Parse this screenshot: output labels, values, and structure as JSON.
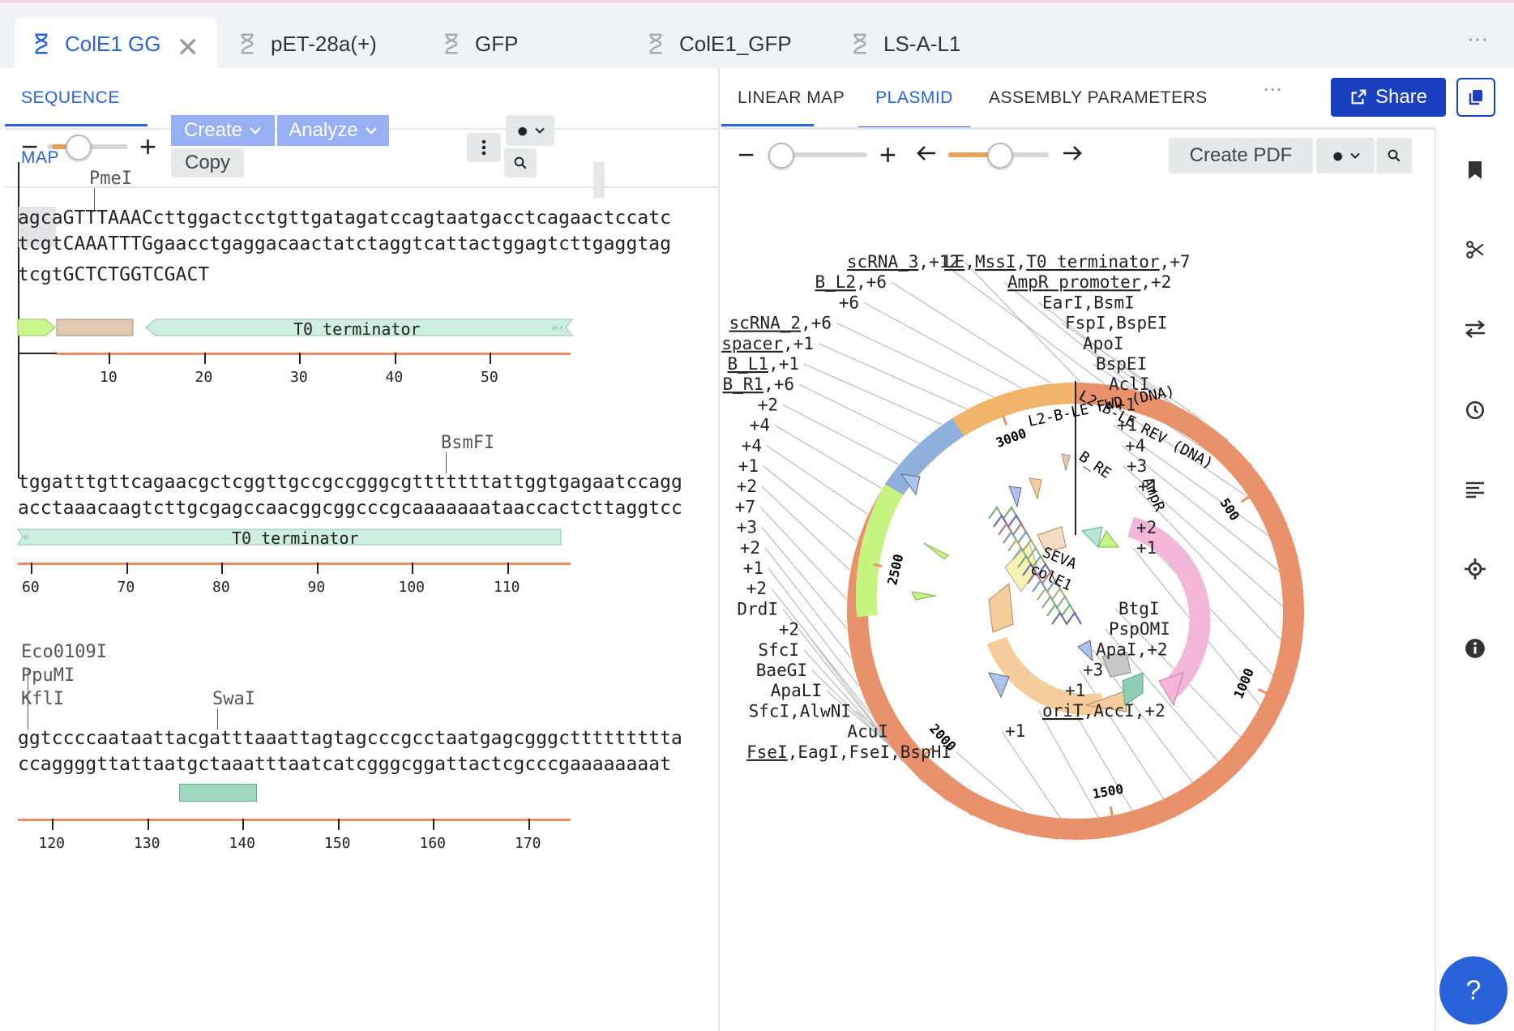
{
  "tabs": [
    {
      "label": "ColE1 GG",
      "active": true
    },
    {
      "label": "pET-28a(+)"
    },
    {
      "label": "GFP"
    },
    {
      "label": "ColE1_GFP"
    },
    {
      "label": "LS-A-L1"
    }
  ],
  "tab_more": "⋯",
  "left": {
    "subtab": "SEQUENCE MAP",
    "toolbar": {
      "create": "Create",
      "analyze": "Analyze",
      "copy": "Copy",
      "minus": "−",
      "plus": "+",
      "zoom": 0.25
    },
    "rows": [
      {
        "cuts": [
          "PmeI"
        ],
        "top": "agcaGTTTAAACcttggactcctgttgatagatccagtaatgacctcagaactccatc",
        "bottom": "tcgtCAAATTTGgaacctgaggacaactatctaggtcattactggagtcttgaggtag",
        "extra": "tcgtGCTCTGGTCGACT",
        "feature": "T0 terminator",
        "ticks": [
          "10",
          "20",
          "30",
          "40",
          "50"
        ]
      },
      {
        "cuts": [
          "BsmFI"
        ],
        "top": "tggatttgttcagaacgctcggttgccgccgggcgtttttttattggtgagaatccagg",
        "bottom": "acctaaacaagtcttgcgagccaacggcggcccgcaaaaaaataaccactcttaggtcc",
        "feature": "T0 terminator",
        "ticks": [
          "60",
          "70",
          "80",
          "90",
          "100",
          "110"
        ]
      },
      {
        "cuts": [
          "Eco0109I",
          "PpuMI",
          "KflI",
          "SwaI"
        ],
        "top": "ggtccccaataattacgatttaaattagtagcccgcctaatgagcgggcttttttttta",
        "bottom": "ccaggggttattaatgctaaatttaatcatcgggcggattactcgcccgaaaaaaaat",
        "ticks": [
          "120",
          "130",
          "140",
          "150",
          "160",
          "170"
        ]
      }
    ]
  },
  "right": {
    "subtabs": [
      "LINEAR MAP",
      "PLASMID",
      "ASSEMBLY PARAMETERS"
    ],
    "active_subtab": "PLASMID",
    "more": "⋯",
    "share": "Share",
    "create_pdf": "Create PDF",
    "zoom": 0.1,
    "rotation": 0.5,
    "plasmid": {
      "ring_ticks": [
        "500",
        "1000",
        "1500",
        "2000",
        "2500",
        "3000"
      ],
      "inner_features": [
        "L2-B-LE REV (DNA)",
        "L2-B-LE FWD (DNA)",
        "B_RE",
        "AmpR",
        "SEVA",
        "colE1"
      ],
      "labels_left": [
        {
          "u": "scRNA_3",
          "t": ",+12"
        },
        {
          "u": "B_L2",
          "t": ",+6"
        },
        {
          "u": "",
          "t": "+6"
        },
        {
          "u": "scRNA_2",
          "t": ",+6"
        },
        {
          "u": "spacer",
          "t": ",+1"
        },
        {
          "u": "B_L1",
          "t": ",+1"
        },
        {
          "u": "B_R1",
          "t": ",+6"
        },
        {
          "u": "",
          "t": "+2"
        },
        {
          "u": "",
          "t": "+4"
        },
        {
          "u": "",
          "t": "+4"
        },
        {
          "u": "",
          "t": "+1"
        },
        {
          "u": "",
          "t": "+2"
        },
        {
          "u": "",
          "t": "+7"
        },
        {
          "u": "",
          "t": "+3"
        },
        {
          "u": "",
          "t": "+2"
        },
        {
          "u": "",
          "t": "+1"
        },
        {
          "u": "",
          "t": "+2"
        },
        {
          "u": "",
          "t": "DrdI"
        },
        {
          "u": "",
          "t": "+2"
        },
        {
          "u": "",
          "t": "SfcI"
        },
        {
          "u": "",
          "t": "BaeGI"
        },
        {
          "u": "",
          "t": "ApaLI"
        },
        {
          "u": "",
          "t": "SfcI,AlwNI"
        },
        {
          "u": "",
          "t": "AcuI"
        },
        {
          "u": "FseI",
          "t": ",EagI,FseI,BspHI"
        }
      ],
      "labels_right": [
        {
          "parts": [
            {
              "u": "LE"
            },
            {
              "t": ","
            },
            {
              "u": "MssI"
            },
            {
              "t": ","
            },
            {
              "u": "T0 terminator"
            },
            {
              "t": ",+7"
            }
          ]
        },
        {
          "parts": [
            {
              "u": "AmpR promoter"
            },
            {
              "t": ",+2"
            }
          ]
        },
        {
          "parts": [
            {
              "t": "EarI,BsmI"
            }
          ]
        },
        {
          "parts": [
            {
              "t": "FspI,BspEI"
            }
          ]
        },
        {
          "parts": [
            {
              "t": "ApoI"
            }
          ]
        },
        {
          "parts": [
            {
              "t": "BspEI"
            }
          ]
        },
        {
          "parts": [
            {
              "t": "AclI"
            }
          ]
        },
        {
          "parts": [
            {
              "t": "+1"
            }
          ]
        },
        {
          "parts": [
            {
              "t": "+1"
            }
          ]
        },
        {
          "parts": [
            {
              "t": "+4"
            }
          ]
        },
        {
          "parts": [
            {
              "t": "+3"
            }
          ]
        },
        {
          "parts": [
            {
              "t": "+1"
            }
          ]
        },
        {
          "parts": [
            {
              "t": "+2"
            }
          ]
        },
        {
          "parts": [
            {
              "t": "+1"
            }
          ]
        },
        {
          "parts": [
            {
              "t": "BtgI"
            }
          ]
        },
        {
          "parts": [
            {
              "t": "PspOMI"
            }
          ]
        },
        {
          "parts": [
            {
              "t": "ApaI,+2"
            }
          ]
        },
        {
          "parts": [
            {
              "t": "+3"
            }
          ]
        },
        {
          "parts": [
            {
              "t": "+1"
            }
          ]
        },
        {
          "parts": [
            {
              "u": "oriT"
            },
            {
              "t": ",AccI,+2"
            }
          ]
        },
        {
          "parts": [
            {
              "t": "+1"
            }
          ]
        }
      ]
    }
  },
  "help": "?",
  "colors": {
    "accent": "#2a62d9",
    "share": "#1a3fbf",
    "ring": "#e8916a",
    "orange": "#f0b46a",
    "blue": "#8fb0dc",
    "green": "#c5f57e",
    "ruler": "#e88d64"
  }
}
